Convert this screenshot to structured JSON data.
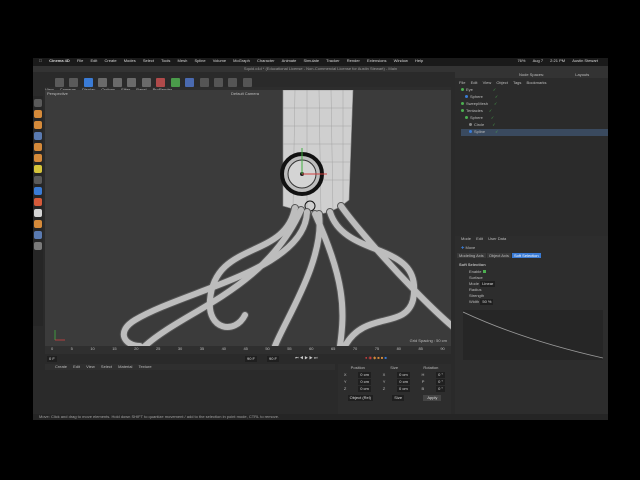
{
  "mac_menu": {
    "apple": "",
    "app_name": "Cinema 4D",
    "items": [
      "File",
      "Edit",
      "Create",
      "Modes",
      "Select",
      "Tools",
      "Mesh",
      "Spline",
      "Volume",
      "MoGraph",
      "Character",
      "Animate",
      "Simulate",
      "Tracker",
      "Render",
      "Extensions",
      "Window",
      "Help"
    ],
    "status": {
      "battery": "76%",
      "date": "Aug 7",
      "time": "2:21 PM",
      "user": "Austin Stewart"
    }
  },
  "window": {
    "title": "Squid.c4d * (Educational License - Non-Commercial License for Austin Stewart) - Main",
    "node_spaces": "Node Spaces:",
    "layout_label": "Layouts"
  },
  "viewport": {
    "menu": [
      "View",
      "Cameras",
      "Display",
      "Options",
      "Filter",
      "Panel",
      "ProRender"
    ],
    "name": "Perspective",
    "camera": "Default Camera",
    "grid_spacing": "Grid Spacing : 50 cm"
  },
  "object_manager": {
    "menu": [
      "File",
      "Edit",
      "View",
      "Object",
      "Tags",
      "Bookmarks"
    ],
    "objects": [
      {
        "name": "Eye"
      },
      {
        "name": "Sphere"
      },
      {
        "name": "SweepMesh"
      },
      {
        "name": "Tentacles"
      },
      {
        "name": "Sphere"
      },
      {
        "name": "Circle"
      },
      {
        "name": "Spline"
      }
    ]
  },
  "attributes": {
    "menu": [
      "Mode",
      "Edit",
      "User Data"
    ],
    "title": "Move",
    "tabs": [
      "Modeling Axis",
      "Object Axis",
      "Soft Selection"
    ],
    "section": "Soft Selection",
    "rows": [
      {
        "label": "Enable",
        "value": ""
      },
      {
        "label": "Surface",
        "value": ""
      },
      {
        "label": "Mode",
        "value": "Linear"
      },
      {
        "label": "Radius",
        "value": ""
      },
      {
        "label": "Strength",
        "value": ""
      },
      {
        "label": "Width",
        "value": "50 %"
      }
    ]
  },
  "timeline": {
    "ticks": [
      "0",
      "5",
      "10",
      "15",
      "20",
      "25",
      "30",
      "35",
      "40",
      "45",
      "50",
      "55",
      "60",
      "65",
      "70",
      "75",
      "80",
      "85",
      "90"
    ],
    "start": "0 F",
    "current": "90 F",
    "end": "90 F"
  },
  "material_menu": [
    "Create",
    "Edit",
    "View",
    "Select",
    "Material",
    "Texture"
  ],
  "coordinates": {
    "headers": [
      "Position",
      "Size",
      "Rotation"
    ],
    "rows": [
      {
        "axis": "X",
        "pos": "0 cm",
        "size_axis": "X",
        "size": "0 cm",
        "rot_axis": "H",
        "rot": "0 °"
      },
      {
        "axis": "Y",
        "pos": "0 cm",
        "size_axis": "Y",
        "size": "0 cm",
        "rot_axis": "P",
        "rot": "0 °"
      },
      {
        "axis": "Z",
        "pos": "0 cm",
        "size_axis": "Z",
        "size": "0 cm",
        "rot_axis": "B",
        "rot": "0 °"
      }
    ],
    "mode": "Object (Rel)",
    "size_mode": "Size",
    "apply_label": "Apply"
  },
  "status_bar": "Move: Click and drag to move elements. Hold down SHIFT to quantize movement / add to the selection in point mode, CTRL to remove.",
  "colors": {
    "accent_blue": "#3a7bd5",
    "green_check": "#4caf50",
    "viewport_bg": "#3b3b3b"
  }
}
